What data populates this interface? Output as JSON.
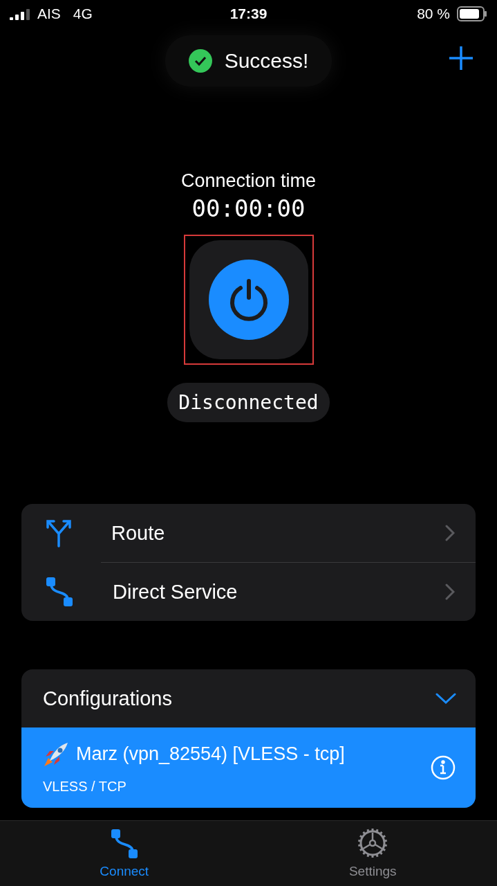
{
  "status_bar": {
    "carrier": "AIS",
    "network": "4G",
    "time": "17:39",
    "battery": "80 %"
  },
  "toast": {
    "message": "Success!"
  },
  "connection": {
    "label": "Connection time",
    "timer": "00:00:00",
    "status": "Disconnected",
    "highlighted": true
  },
  "menu": [
    {
      "kind": "route",
      "label": "Route"
    },
    {
      "kind": "direct",
      "label": "Direct Service"
    }
  ],
  "configurations": {
    "title": "Configurations",
    "expanded": true,
    "items": [
      {
        "name": "Marz (vpn_82554) [VLESS - tcp]",
        "protocol": "VLESS / TCP",
        "selected": true
      }
    ]
  },
  "tabs": [
    {
      "kind": "connect",
      "label": "Connect",
      "selected": true
    },
    {
      "kind": "settings",
      "label": "Settings",
      "selected": false
    }
  ]
}
